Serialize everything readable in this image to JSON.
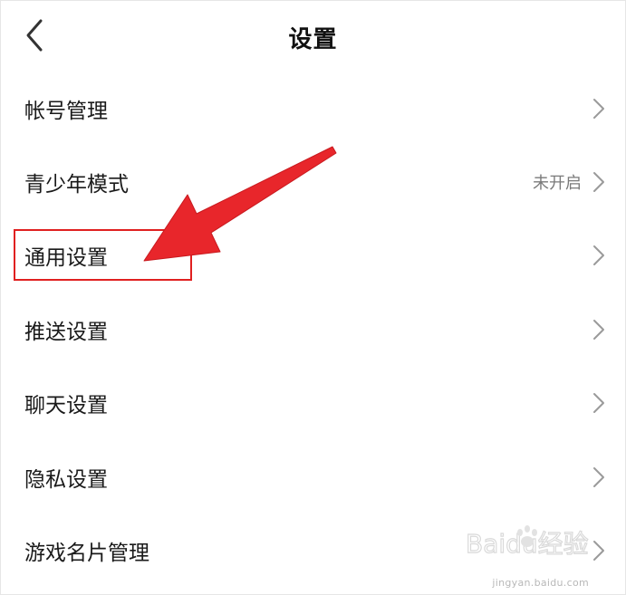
{
  "header": {
    "title": "设置",
    "back_icon": "chevron-left-icon"
  },
  "settings": {
    "items": [
      {
        "label": "帐号管理",
        "value": ""
      },
      {
        "label": "青少年模式",
        "value": "未开启"
      },
      {
        "label": "通用设置",
        "value": ""
      },
      {
        "label": "推送设置",
        "value": ""
      },
      {
        "label": "聊天设置",
        "value": ""
      },
      {
        "label": "隐私设置",
        "value": ""
      },
      {
        "label": "游戏名片管理",
        "value": ""
      }
    ]
  },
  "annotation": {
    "highlight_color": "#e02020",
    "highlighted_item": "通用设置"
  },
  "watermark": {
    "brand": "Baidu经验",
    "url": "jingyan.baidu.com"
  }
}
